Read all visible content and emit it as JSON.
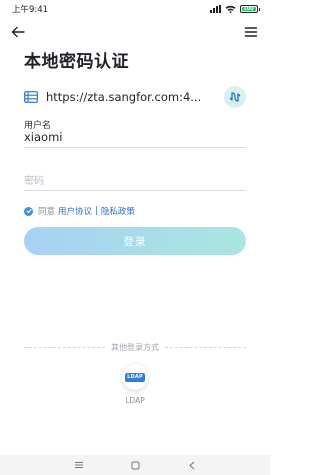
{
  "status_bar": {
    "time": "上午9:41",
    "battery": "100",
    "icons": [
      "signal-icon",
      "wifi-icon",
      "battery-icon"
    ]
  },
  "nav": {
    "back_icon": "arrow-left-icon",
    "menu_icon": "menu-icon"
  },
  "page": {
    "title": "本地密码认证"
  },
  "server": {
    "icon": "server-icon",
    "url": "https://zta.sangfor.com:4...",
    "switch_icon": "switch-server-icon"
  },
  "username": {
    "label": "用户名",
    "value": "xiaomi"
  },
  "password": {
    "placeholder": "密码",
    "value": ""
  },
  "agreement": {
    "checked": true,
    "prefix": "同意",
    "user_agreement": "用户协议",
    "separator": "|",
    "privacy_policy": "隐私政策"
  },
  "login_button": {
    "label": "登录"
  },
  "other_login": {
    "divider_text": "其他登录方式",
    "methods": [
      {
        "badge": "LDAP",
        "label": "LDAP"
      }
    ]
  },
  "colors": {
    "link": "#2a6fd6",
    "button_gradient_start": "#a8d1f3",
    "button_gradient_end": "#a9e6df",
    "switch_bg": "#d9f0f3"
  }
}
